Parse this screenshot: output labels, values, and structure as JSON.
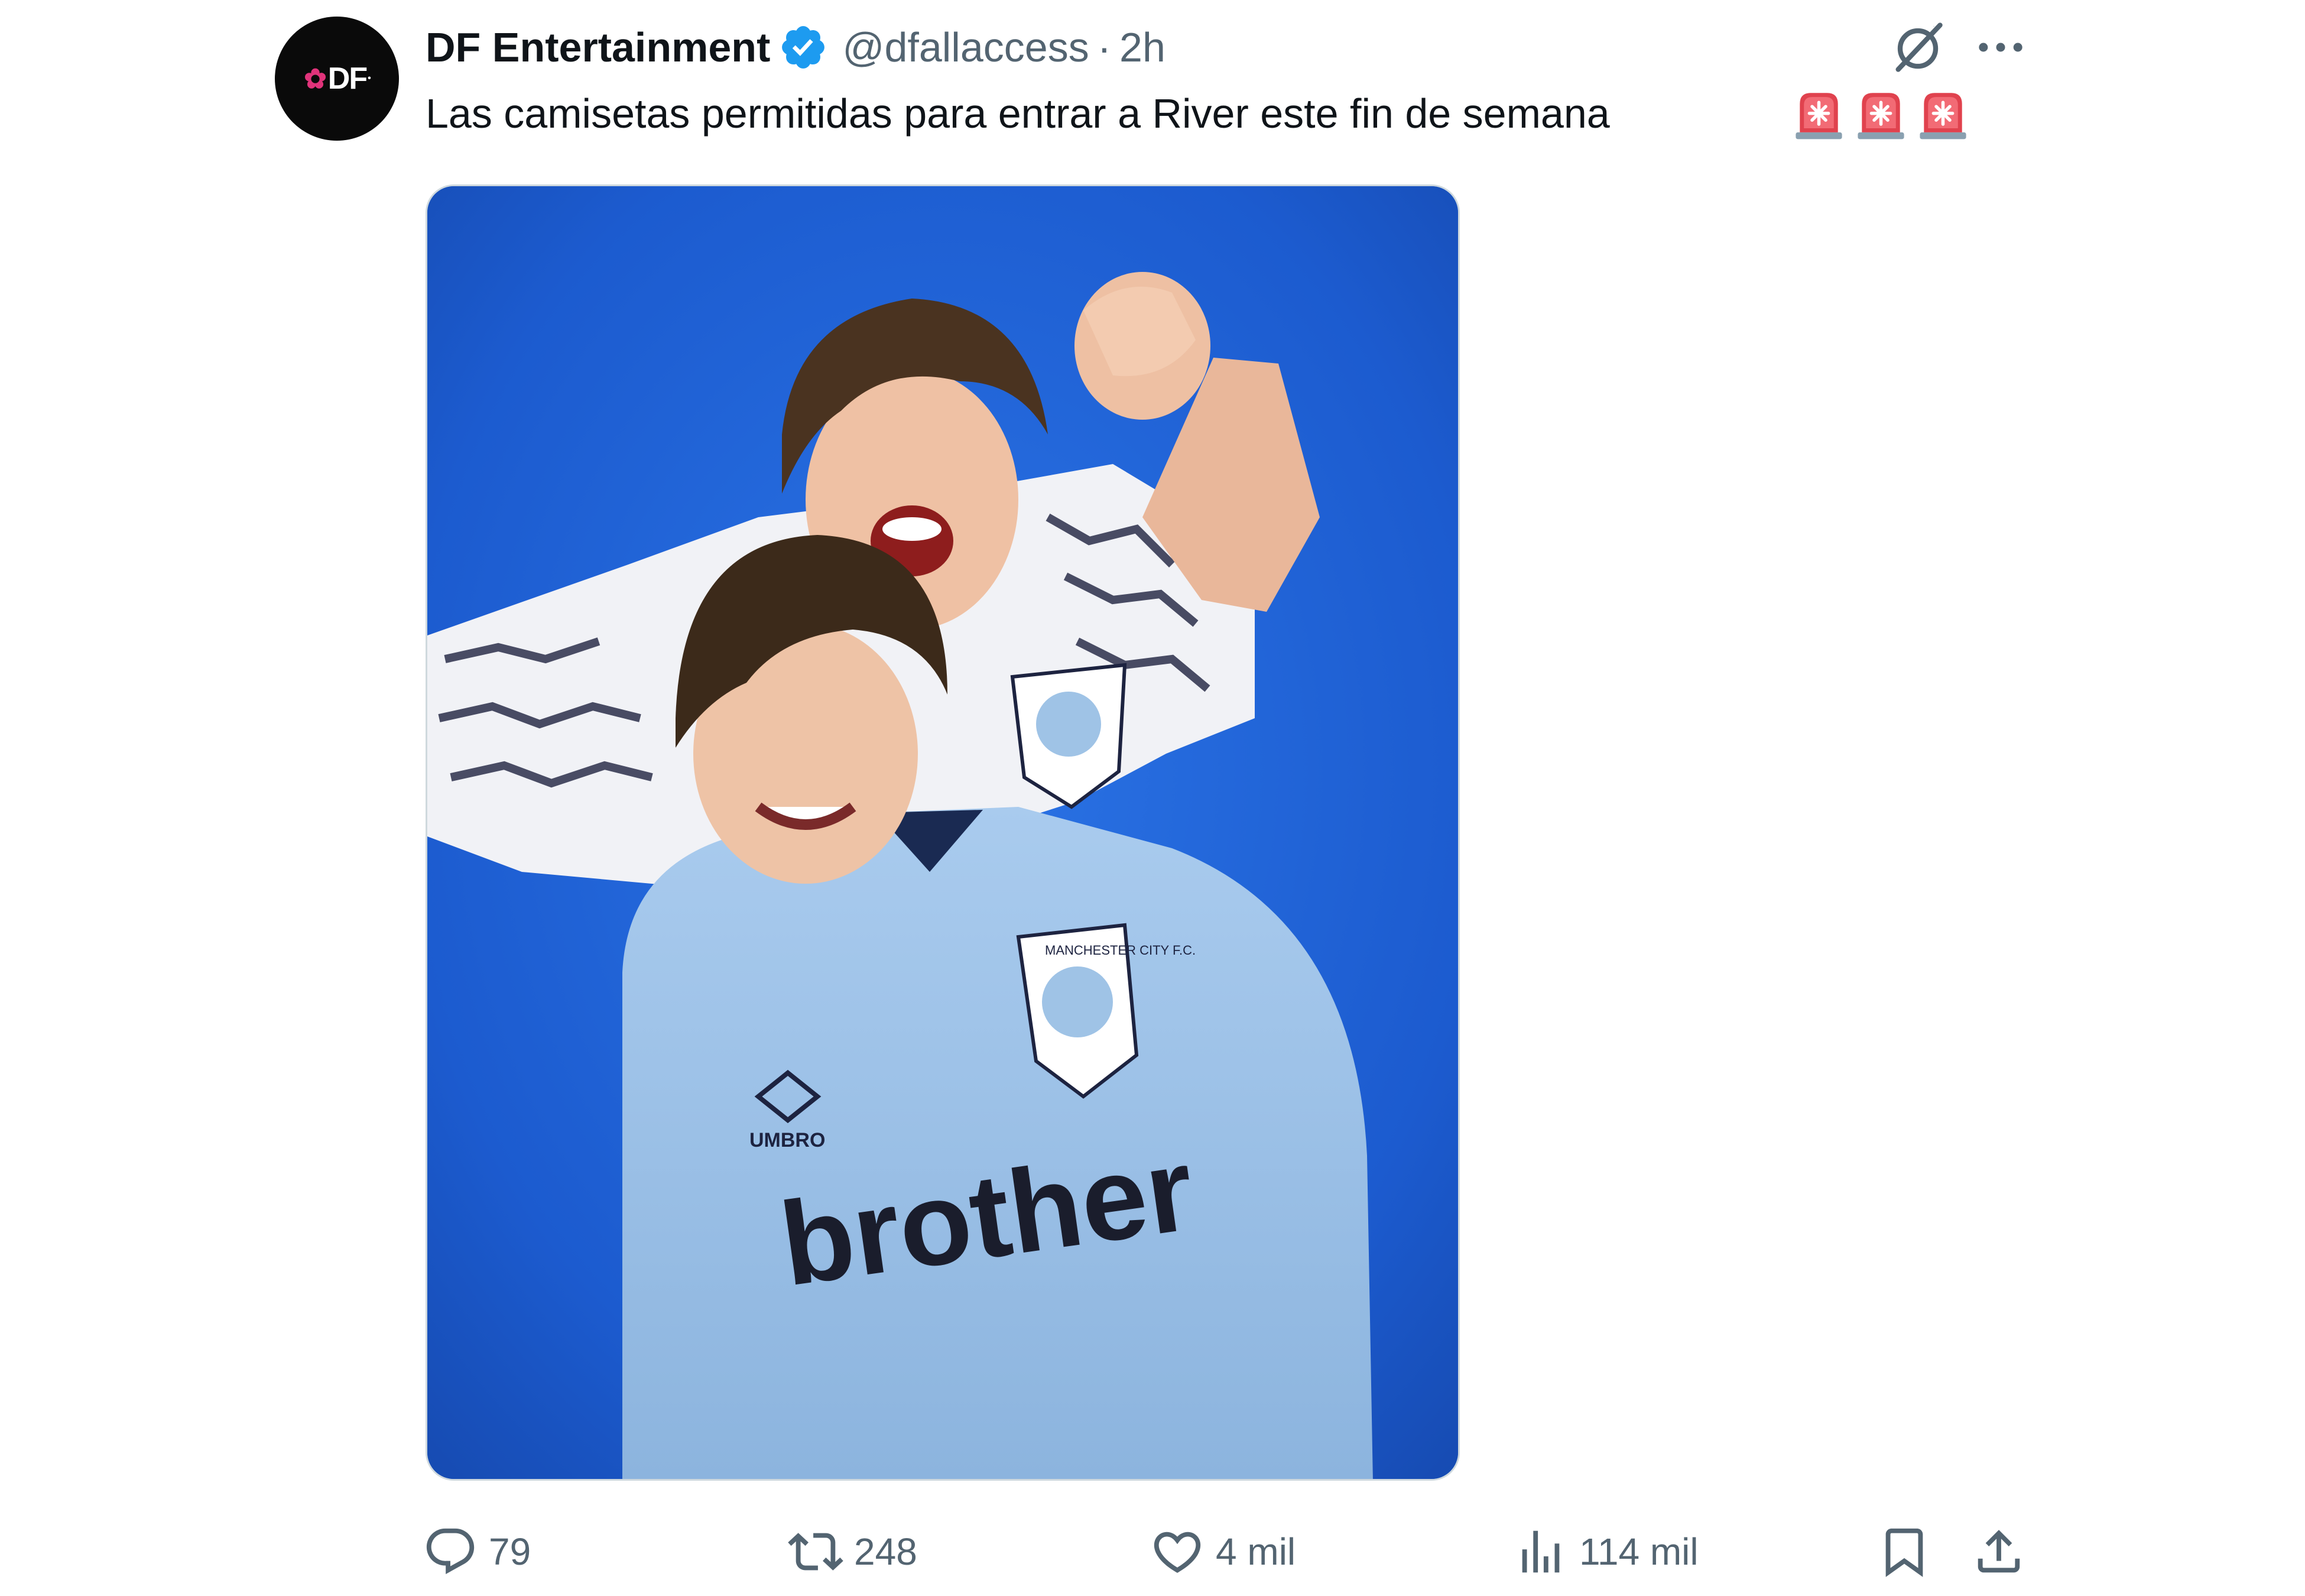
{
  "account": {
    "display_name": "DF Entertainment",
    "handle": "@dfallaccess",
    "separator": "·",
    "timestamp": "2h",
    "avatar_text": "DF",
    "verified": true,
    "verified_color": "#1d9bf0"
  },
  "tweet": {
    "text": "Las camisetas permitidas para entrar a River este fin de semana",
    "emojis": [
      "rotating-light-icon",
      "rotating-light-icon",
      "rotating-light-icon"
    ]
  },
  "media": {
    "type": "photo",
    "shirt_sponsor": "brother",
    "kit_brand": "UMBRO",
    "badge_text": "MANCHESTER CITY F.C."
  },
  "actions": {
    "replies": "79",
    "reposts": "248",
    "likes": "4 mil",
    "views": "114 mil"
  },
  "icons": {
    "reply": "reply-icon",
    "repost": "repost-icon",
    "like": "heart-icon",
    "views": "views-chart-icon",
    "bookmark": "bookmark-icon",
    "share": "share-icon",
    "grok": "grok-icon",
    "more": "more-icon"
  },
  "colors": {
    "text_primary": "#0f1419",
    "text_secondary": "#536471",
    "photo_background": "#1f5fd2",
    "shirt_sky_blue": "#9fc3e6"
  }
}
